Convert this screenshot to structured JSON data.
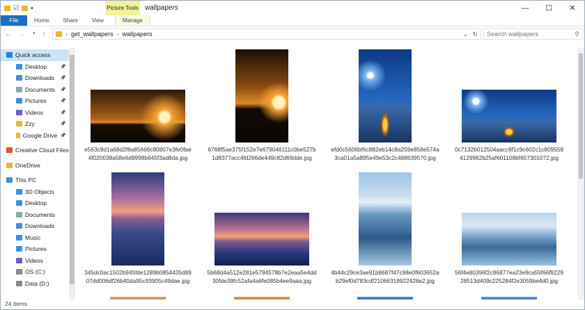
{
  "window": {
    "title": "wallpapers",
    "context_tab": "Picture Tools"
  },
  "ribbon": {
    "tabs": [
      "File",
      "Home",
      "Share",
      "View",
      "Manage"
    ]
  },
  "address": {
    "segments": [
      "get_wallpapers",
      "wallpapers"
    ],
    "search_placeholder": "Search wallpapers"
  },
  "sidebar": {
    "items": [
      {
        "label": "Quick access",
        "level": 1,
        "icon": "star-icon",
        "color": "#2a7fd4",
        "selected": true
      },
      {
        "label": "Desktop",
        "level": 2,
        "icon": "folder-icon",
        "color": "#3b8fe0",
        "pinned": true
      },
      {
        "label": "Downloads",
        "level": 2,
        "icon": "download-icon",
        "color": "#3b8fe0",
        "pinned": true
      },
      {
        "label": "Documents",
        "level": 2,
        "icon": "document-icon",
        "color": "#8aa",
        "pinned": true
      },
      {
        "label": "Pictures",
        "level": 2,
        "icon": "pictures-icon",
        "color": "#3b8fe0",
        "pinned": true
      },
      {
        "label": "Videos",
        "level": 2,
        "icon": "videos-icon",
        "color": "#7a5bc4",
        "pinned": true
      },
      {
        "label": "Zzy",
        "level": 2,
        "icon": "folder-icon",
        "color": "#e8b830",
        "pinned": true
      },
      {
        "label": "Google Drive",
        "level": 2,
        "icon": "folder-icon",
        "color": "#e8b830",
        "pinned": true
      },
      {
        "label": "Creative Cloud Files",
        "level": 1,
        "icon": "creative-cloud-icon",
        "color": "#e05030"
      },
      {
        "label": "OneDrive",
        "level": 1,
        "icon": "onedrive-icon",
        "color": "#e8b830"
      },
      {
        "label": "This PC",
        "level": 1,
        "icon": "pc-icon",
        "color": "#3b8fe0"
      },
      {
        "label": "3D Objects",
        "level": 2,
        "icon": "3d-objects-icon",
        "color": "#3b8fe0"
      },
      {
        "label": "Desktop",
        "level": 2,
        "icon": "folder-icon",
        "color": "#3b8fe0"
      },
      {
        "label": "Documents",
        "level": 2,
        "icon": "document-icon",
        "color": "#8aa"
      },
      {
        "label": "Downloads",
        "level": 2,
        "icon": "download-icon",
        "color": "#3b8fe0"
      },
      {
        "label": "Music",
        "level": 2,
        "icon": "music-icon",
        "color": "#3b8fe0"
      },
      {
        "label": "Pictures",
        "level": 2,
        "icon": "pictures-icon",
        "color": "#3b8fe0"
      },
      {
        "label": "Videos",
        "level": 2,
        "icon": "videos-icon",
        "color": "#7a5bc4"
      },
      {
        "label": "OS (C:)",
        "level": 2,
        "icon": "drive-icon",
        "color": "#888"
      },
      {
        "label": "Data (D:)",
        "level": 2,
        "icon": "drive-icon",
        "color": "#888"
      }
    ]
  },
  "files": [
    {
      "name": "e563c9d1a68d2f8a85666c80807e3fe0fae4f020038a58e6d9998b645f3ad8da.jpg",
      "kind": "cheetah-landscape"
    },
    {
      "name": "6768f5ae375f152e7e679046111c0be527b1d8377acc4fd266de449c82d69dde.jpg",
      "kind": "cheetah-portrait"
    },
    {
      "name": "efd0c5606bf6c882eb14c8a259e858e574a3ca01a5a895e49e53c2c488639570.jpg",
      "kind": "tent-portrait"
    },
    {
      "name": "0c7132b012504aacc8f1c9c602c1c8095594129962b25af601108bf657301072.jpg",
      "kind": "tent-landscape"
    },
    {
      "name": "345dc0ac1502b945fde1289b0854435d8907dd006df26b40da95c93905c49dae.jpg",
      "kind": "sunset-portrait"
    },
    {
      "name": "5b68d4a512e281e5794578b7e2eaa5e4dd30fde39fc52afa4a6fe085b4ee9aaa.jpg",
      "kind": "sunset-landscape"
    },
    {
      "name": "4b44c29ce3ae91b8687f47c98e0f603652ab29ef0d783cdf21066319922428e2.jpg",
      "kind": "ice-portrait"
    },
    {
      "name": "56f4e80396f2c86877ea23e9ca55f66f922928513d409c225284f2e3059be4d0.jpg",
      "kind": "ice-landscape"
    }
  ],
  "status": {
    "item_count": "24 items"
  }
}
